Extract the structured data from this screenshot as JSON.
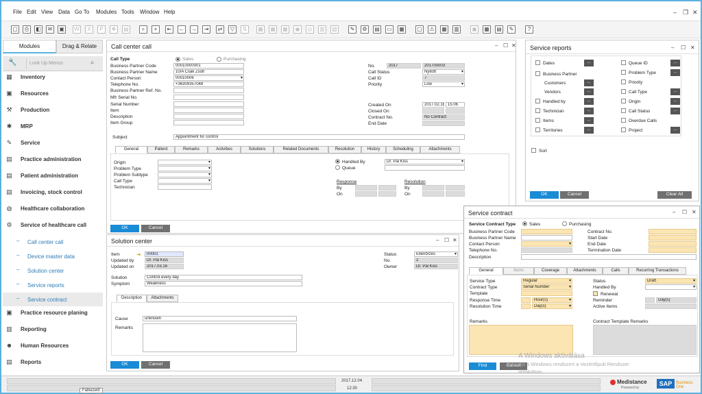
{
  "menu": [
    "File",
    "Edit",
    "View",
    "Data",
    "Go To",
    "Modules",
    "Tools",
    "Window",
    "Help"
  ],
  "modules": {
    "tab_active": "Modules",
    "tab_other": "Drag & Relate",
    "lookup_placeholder": "Look Up Menus",
    "items": [
      "Inventory",
      "Resources",
      "Production",
      "MRP",
      "Service",
      "Practice administration",
      "Patient administration",
      "Invoicing, stock control",
      "Healthcare collaboration",
      "Service of healthcare call"
    ],
    "subitems": [
      "Call center call",
      "Device master data",
      "Solution center",
      "Service reports",
      "Service contract"
    ],
    "items_bottom": [
      "Practice resource planing",
      "Reporting",
      "Human Resources",
      "Reports"
    ]
  },
  "call_center": {
    "title": "Call center call",
    "call_type": "Call Type",
    "sales": "Sales",
    "purchasing": "Purchasing",
    "left_labels": [
      "Business Partner Code",
      "Business Partner Name",
      "Contact Person",
      "Telephone No.",
      "Business Partner Ref. No.",
      "Mfr Serial No.",
      "Serial Number",
      "Item",
      "Description",
      "Item Group"
    ],
    "left_values": [
      "00010000001",
      "10/A Csák Zsolt",
      "00010006",
      "+36309357048",
      "",
      "",
      "",
      "",
      "",
      ""
    ],
    "right_labels": [
      "No.",
      "Call Status",
      "Call ID",
      "Priority",
      "Created On",
      "Closed On",
      "Contract No.",
      "End Date"
    ],
    "no_series": "2017",
    "no_value": "201700003",
    "call_status": "Nyitott",
    "call_id": "7",
    "priority": "Low",
    "created_date": "2017.02.16",
    "created_time": "15:06",
    "contract_no": "No Contract",
    "subject_label": "Subject",
    "subject": "Appointment for control",
    "tabs": [
      "General",
      "Patient",
      "Remarks",
      "Activities",
      "Solutions",
      "Related Documents",
      "Resolution",
      "History",
      "Scheduling",
      "Attachments"
    ],
    "gen_labels": [
      "Origin",
      "Problem Type",
      "Problem Subtype",
      "Call Type",
      "Technician"
    ],
    "handled_by": "Handled By",
    "handled_value": "Dr. Pál Kiss",
    "queue": "Queue",
    "response": "Response",
    "resolution": "Resolution",
    "by": "By",
    "on": "On",
    "ok": "OK",
    "cancel": "Cancel"
  },
  "solution": {
    "title": "Solution center",
    "labels": [
      "Item",
      "Updated by",
      "Updated on"
    ],
    "item": "00001",
    "updated_by": "Dr. Pál Kiss",
    "updated_on": "2017.03.16",
    "status_label": "Status",
    "status": "Ellenőrzés",
    "no_label": "No.",
    "no": "2",
    "owner_label": "Owner",
    "owner": "Dr. Pál Kiss",
    "solution_label": "Solution",
    "solution": "Control every day",
    "symptom_label": "Symptom",
    "symptom": "Weakness",
    "tabs": [
      "Description",
      "Attachments"
    ],
    "cause_label": "Cause",
    "cause": "unknown",
    "remarks_label": "Remarks",
    "ok": "OK",
    "cancel": "Cancel"
  },
  "reports": {
    "title": "Service reports",
    "left": [
      "Dates",
      "Business Partner",
      "Customers",
      "Vendors",
      "Handled by",
      "Technician",
      "Items",
      "Territories"
    ],
    "right": [
      "Queue ID",
      "Problem Type",
      "Priority",
      "Call Type",
      "Origin",
      "Call Status",
      "Overdue Calls",
      "Project"
    ],
    "sort": "Sort",
    "ok": "OK",
    "cancel": "Cancel",
    "clear": "Clear All",
    "dots": "..."
  },
  "contract": {
    "title": "Service contract",
    "type_label": "Service Contract Type",
    "sales": "Sales",
    "purchasing": "Purchasing",
    "left_labels": [
      "Business Partner Code",
      "Business Partner Name",
      "Contact Person",
      "Telephone No.",
      "Description"
    ],
    "right_labels": [
      "Contract No.",
      "Start Date",
      "End Date",
      "Termination Date"
    ],
    "tabs": [
      "General",
      "Items",
      "Coverage",
      "Attachments",
      "Calls",
      "Recurring Transactions"
    ],
    "g_left": [
      "Service Type",
      "Contract Type",
      "Template",
      "Response Time",
      "Resolution Time"
    ],
    "service_type": "Regular",
    "contract_type": "Serial Number",
    "hours": "Hour(s)",
    "days": "Day(s)",
    "g_right": [
      "Status",
      "Handled By",
      "Renewal",
      "Reminder",
      "Active Items"
    ],
    "status": "Draft",
    "reminder_unit": "Day(s)",
    "remarks": "Remarks",
    "tpl_remarks": "Contract Template Remarks",
    "find": "Find",
    "cancel": "Cancel"
  },
  "status": {
    "date": "2017.12.04",
    "time": "12:30",
    "user": "Fálkezelő",
    "brand": "Medistance",
    "brand_sub": "Powered by",
    "sap": "SAP",
    "b1": "Business One"
  },
  "watermark": {
    "line1": "A Windows aktiválása",
    "line2": "Aktiválja a Windows rendszert a Vezérlőpult Rendszer",
    "line3": "ablakában."
  }
}
